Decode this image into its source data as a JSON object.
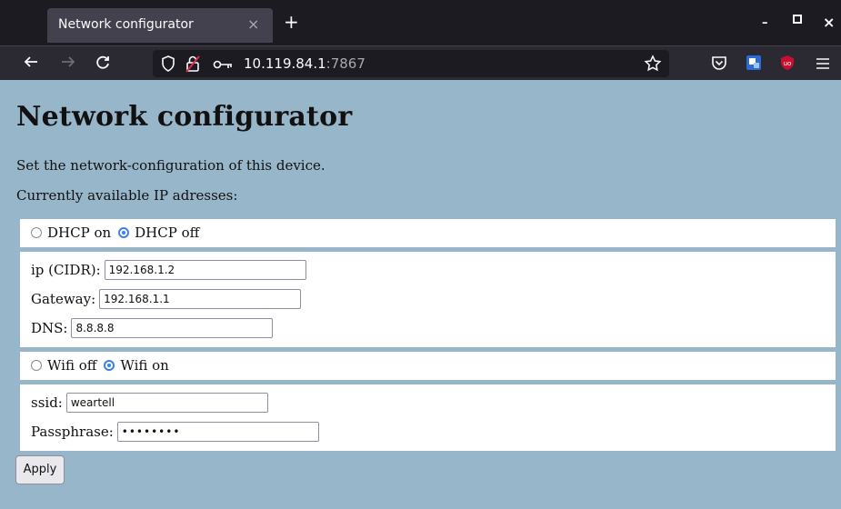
{
  "browser": {
    "tab_title": "Network configurator",
    "tab_close": "×",
    "new_tab": "+",
    "url_host": "10.119.84.1",
    "url_port": ":7867",
    "window_controls": {
      "minimize": "–",
      "maximize": "▫",
      "close": "×"
    },
    "icons": [
      "back-arrow-icon",
      "forward-arrow-icon",
      "reload-icon",
      "shield-icon",
      "insecure-lock-icon",
      "key-icon",
      "star-icon",
      "pocket-icon",
      "extension-icon",
      "ublock-icon",
      "menu-icon"
    ],
    "colors": {
      "titlebar": "#1c1b22",
      "tab": "#42414d",
      "navbar": "#2b2a33"
    }
  },
  "page": {
    "title": "Network configurator",
    "description": "Set the network-configuration of this device.",
    "available_label": "Currently available IP adresses:",
    "dhcp": {
      "on_label": "DHCP on",
      "off_label": "DHCP off",
      "selected": "off"
    },
    "ip": {
      "label": "ip (CIDR):",
      "value": "192.168.1.2"
    },
    "gateway": {
      "label": "Gateway:",
      "value": "192.168.1.1"
    },
    "dns": {
      "label": "DNS:",
      "value": "8.8.8.8"
    },
    "wifi": {
      "off_label": "Wifi off",
      "on_label": "Wifi on",
      "selected": "on"
    },
    "ssid": {
      "label": "ssid:",
      "value": "weartell"
    },
    "passphrase": {
      "label": "Passphrase:",
      "value": "••••••••"
    },
    "apply_label": "Apply",
    "colors": {
      "background": "#97b6c9",
      "panel": "#ffffff",
      "radio_accent": "#3b7fe0"
    }
  }
}
